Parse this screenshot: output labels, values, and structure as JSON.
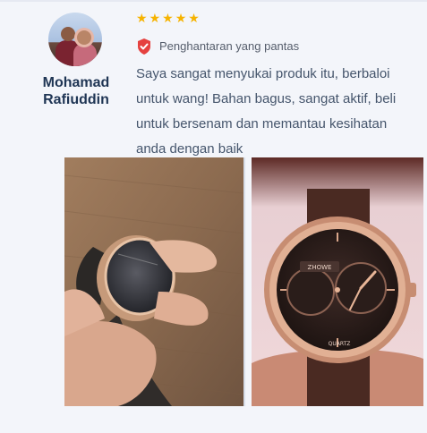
{
  "review": {
    "reviewer_name": "Mohamad Rafiuddin",
    "rating": 5,
    "verified_label": "Penghantaran yang pantas",
    "text": "Saya sangat menyukai produk itu, berbaloi untuk wang! Bahan bagus, sangat aktif, beli untuk bersenam dan memantau kesihatan anda dengan baik",
    "colors": {
      "star": "#f6b300",
      "badge": "#e5413f",
      "name": "#1f3554"
    },
    "photos": [
      {
        "icon": "watch-photo-side"
      },
      {
        "icon": "watch-photo-front"
      }
    ]
  }
}
